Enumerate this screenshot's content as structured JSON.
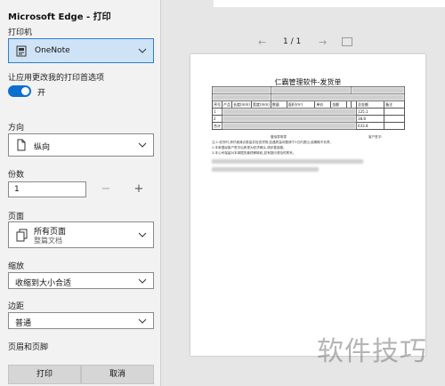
{
  "dialog": {
    "title": "Microsoft Edge - 打印"
  },
  "printer": {
    "label": "打印机",
    "value": "OneNote"
  },
  "app_prefs": {
    "label": "让应用更改我的打印首选项",
    "toggle_state": "开",
    "toggle_on": true
  },
  "orientation": {
    "label": "方向",
    "value": "纵向"
  },
  "copies": {
    "label": "份数",
    "value": "1",
    "minus": "−",
    "plus": "+"
  },
  "pages": {
    "label": "页面",
    "value": "所有页面",
    "sub": "整篇文档"
  },
  "scale": {
    "label": "缩放",
    "value": "收缩到大小合适"
  },
  "margins": {
    "label": "边距",
    "value": "普通"
  },
  "header_footer": {
    "label": "页眉和页脚"
  },
  "buttons": {
    "print": "打印",
    "cancel": "取消"
  },
  "preview": {
    "page_indicator": "1 / 1",
    "prev": "←",
    "next": "→",
    "document": {
      "title": "仁霸管理软件-发货单",
      "columns": [
        "序号",
        "产品",
        "长度(mm)",
        "宽度(mm)",
        "数量",
        "面积(m²)",
        "单价",
        "金额",
        "",
        "",
        "总金额",
        "备注"
      ],
      "rows": [
        [
          "1",
          "",
          "",
          "",
          "",
          "",
          "",
          "",
          "",
          "",
          "125.1",
          ""
        ],
        [
          "2",
          "",
          "",
          "",
          "",
          "",
          "",
          "",
          "",
          "",
          "38.8",
          ""
        ],
        [
          "合计",
          "",
          "",
          "",
          "",
          "",
          "",
          "",
          "",
          "",
          "633.8",
          ""
        ]
      ],
      "amount_words": "壹佰零角零",
      "customer_sign": "客户签字:",
      "notes": [
        "注:1.收货时,请仔细清点数量并检查货物,如遇质量问题请于3日内提出,逾期概不负责。",
        "2.本单据经客户签字后即视为收货确认,请妥善保管。",
        "3.本公司保留对本单据的最终解释权,如有疑问请及时联系。"
      ]
    }
  },
  "watermark": "软件技巧"
}
